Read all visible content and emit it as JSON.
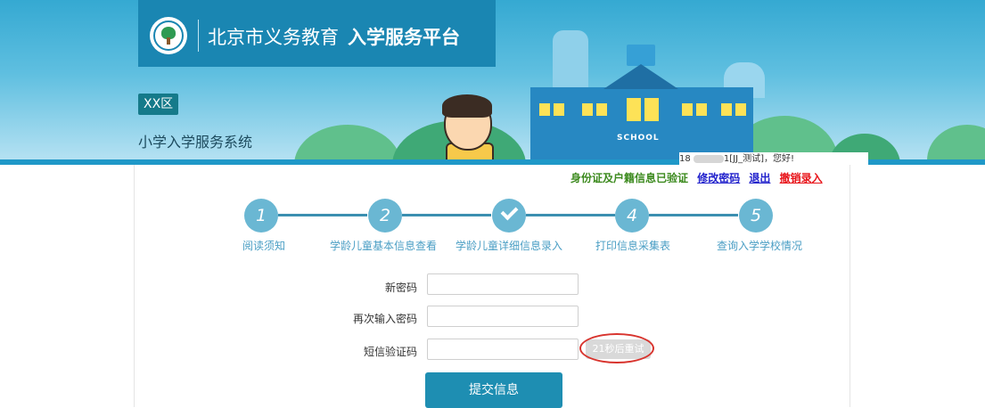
{
  "header": {
    "title_regular": "北京市义务教育",
    "title_bold": "入学服务平台",
    "district": "XX区",
    "system_name": "小学入学服务系统",
    "school_sign": "SCHOOL"
  },
  "user": {
    "greeting_prefix": "18",
    "greeting_suffix": "1[JJ_测试]，您好!"
  },
  "status_bar": {
    "verified": "身份证及户籍信息已验证",
    "change_password": "修改密码",
    "logout": "退出",
    "revoke": "撤销录入"
  },
  "steps": [
    {
      "number": "1",
      "label": "阅读须知"
    },
    {
      "number": "2",
      "label": "学龄儿童基本信息查看"
    },
    {
      "number": "",
      "label": "学龄儿童详细信息录入",
      "completed": true
    },
    {
      "number": "4",
      "label": "打印信息采集表"
    },
    {
      "number": "5",
      "label": "查询入学学校情况"
    }
  ],
  "form": {
    "new_password_label": "新密码",
    "new_password_value": "",
    "confirm_password_label": "再次输入密码",
    "confirm_password_value": "",
    "sms_code_label": "短信验证码",
    "sms_code_value": "",
    "retry_button": "21秒后重试",
    "submit_button": "提交信息"
  },
  "colors": {
    "banner": "#35a9d2",
    "title_box": "#1a86b2",
    "step_circle": "#6ab7d3",
    "step_label": "#4a9ec4",
    "submit": "#1e8eb2",
    "verified_text": "#3c8a1e",
    "link_blue": "#2222cc",
    "link_red": "#e8141a",
    "highlight_ring": "#d8342e"
  }
}
